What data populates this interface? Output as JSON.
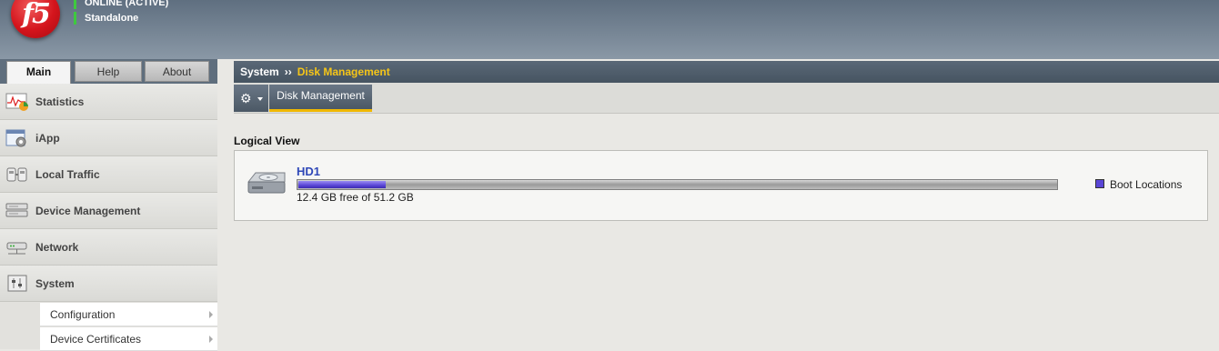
{
  "header": {
    "logo_text": "f5",
    "status_online": "ONLINE (ACTIVE)",
    "status_mode": "Standalone",
    "status_color": "#3ec93e"
  },
  "tabs": [
    {
      "label": "Main",
      "active": true
    },
    {
      "label": "Help",
      "active": false
    },
    {
      "label": "About",
      "active": false
    }
  ],
  "sidebar": {
    "items": [
      {
        "label": "Statistics",
        "icon": "statistics-chart-icon"
      },
      {
        "label": "iApp",
        "icon": "iapp-gear-icon"
      },
      {
        "label": "Local Traffic",
        "icon": "local-traffic-icon"
      },
      {
        "label": "Device Management",
        "icon": "device-management-icon"
      },
      {
        "label": "Network",
        "icon": "network-icon"
      },
      {
        "label": "System",
        "icon": "system-icon"
      }
    ],
    "system_subitems": [
      "Configuration",
      "Device Certificates"
    ]
  },
  "breadcrumb": {
    "section": "System",
    "separator": "››",
    "page": "Disk Management"
  },
  "subtabs": {
    "gear_icon": "gear-icon",
    "active_tab": "Disk Management"
  },
  "logical_view": {
    "title": "Logical View",
    "disk": {
      "name": "HD1",
      "free_gb": 12.4,
      "total_gb": 51.2,
      "summary": "12.4 GB free of 51.2 GB",
      "boot_fraction": 0.115
    },
    "legend": {
      "label": "Boot Locations",
      "color": "#5a46d6"
    }
  }
}
